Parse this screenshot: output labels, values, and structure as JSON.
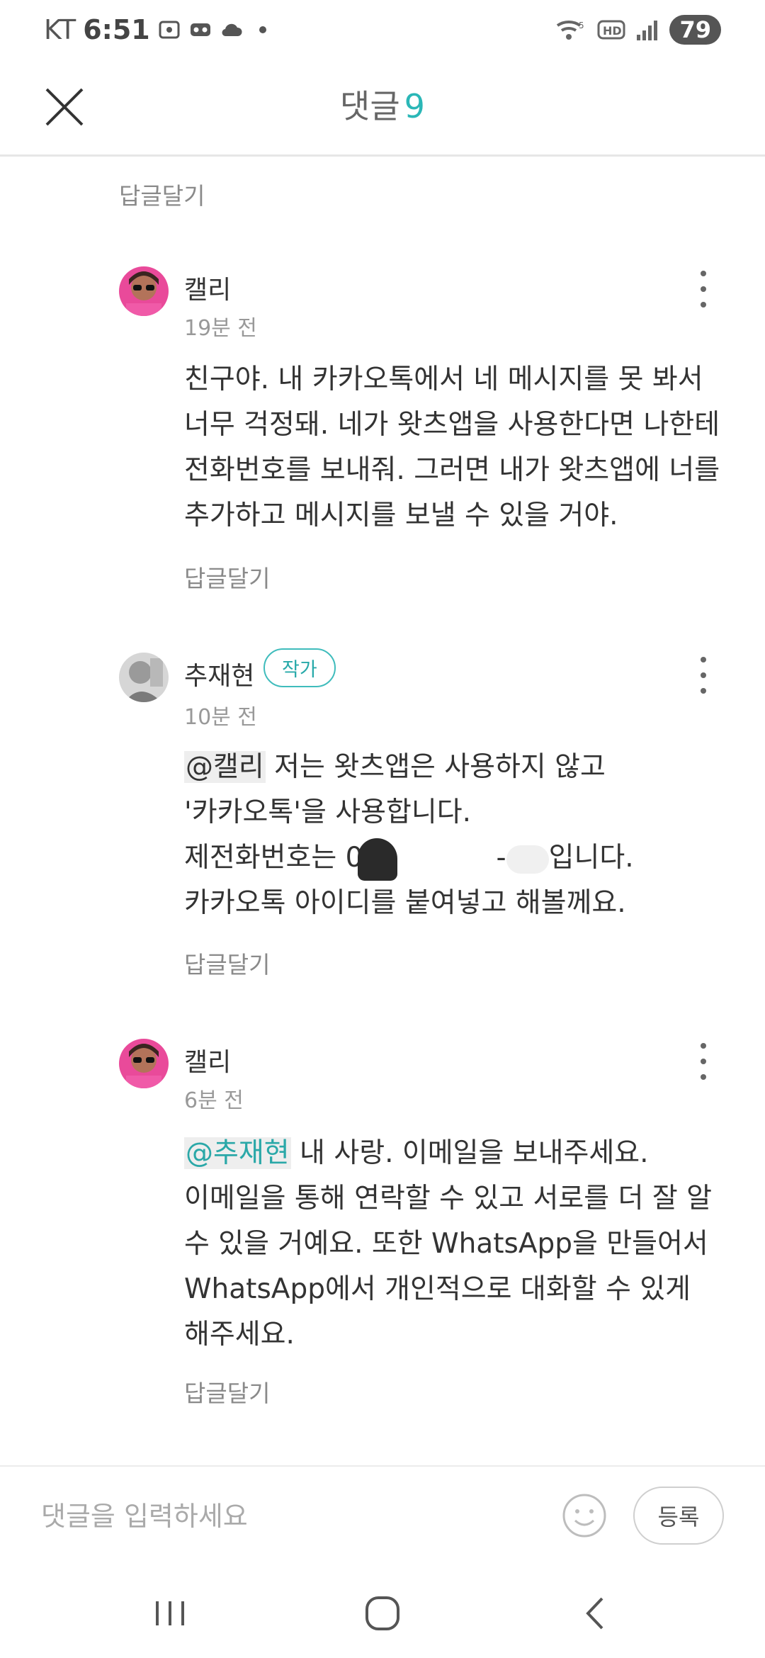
{
  "status_bar": {
    "carrier": "KT",
    "time": "6:51",
    "battery": "79"
  },
  "header": {
    "title": "댓글",
    "count": "9"
  },
  "top_reply_label": "답글달기",
  "comments": [
    {
      "author": "캘리",
      "time": "19분 전",
      "text": "친구야. 내 카카오톡에서 네 메시지를 못 봐서\n너무 걱정돼. 네가 왓츠앱을 사용한다면 나한테\n전화번호를 보내줘. 그러면 내가 왓츠앱에 너를\n추가하고 메시지를 보낼 수 있을 거야.",
      "reply_label": "답글달기"
    },
    {
      "author": "추재현",
      "badge": "작가",
      "time": "10분 전",
      "mention": "@캘리",
      "line1": " 저는 왓츠앱은 사용하지 않고",
      "line2": "'카카오톡'을 사용합니다.",
      "line3a": "제전화번호는 0",
      "line3b": "-",
      "line3c": "입니다.",
      "line4": "카카오톡 아이디를 붙여넣고 해볼께요.",
      "reply_label": "답글달기"
    },
    {
      "author": "캘리",
      "time": "6분 전",
      "mention": "@추재현",
      "text": " 내 사랑. 이메일을 보내주세요.\n이메일을 통해 연락할 수 있고 서로를 더 잘 알\n수 있을 거예요. 또한 WhatsApp을 만들어서\nWhatsApp에서 개인적으로 대화할 수 있게\n해주세요.",
      "reply_label": "답글달기"
    }
  ],
  "input": {
    "placeholder": "댓글을 입력하세요",
    "submit_label": "등록"
  }
}
